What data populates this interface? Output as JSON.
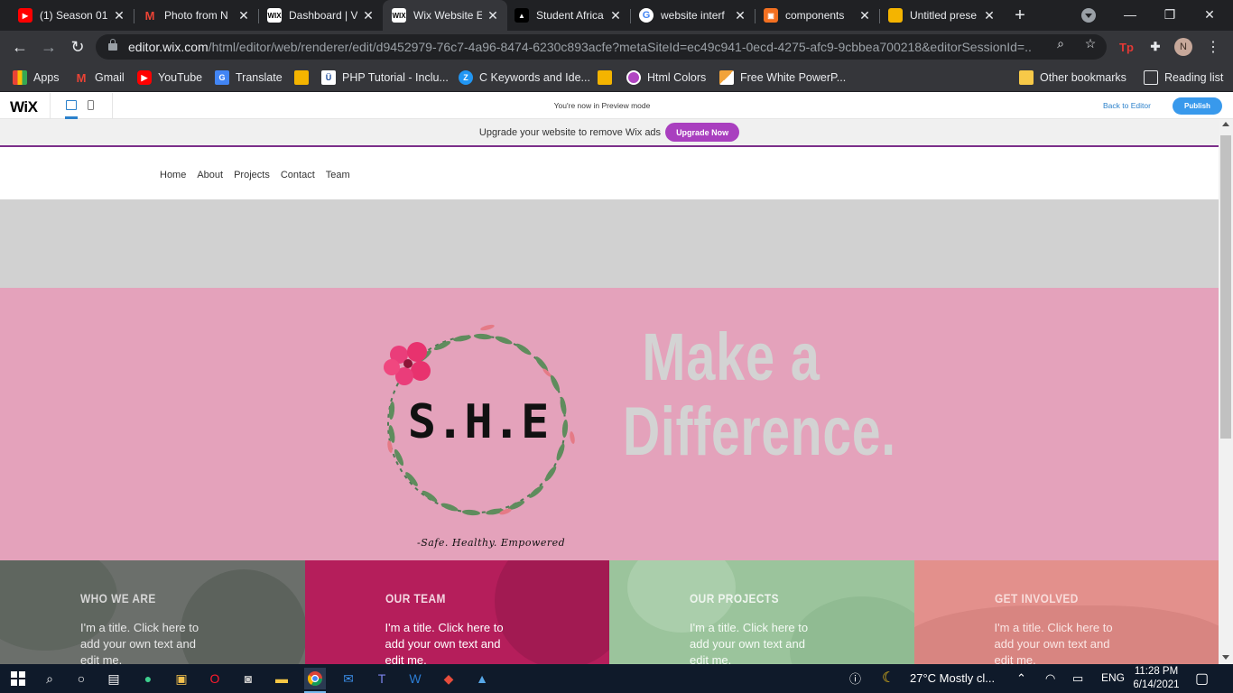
{
  "browser": {
    "tabs": [
      {
        "title": "(1) Season 01",
        "icon": "youtube-icon",
        "color": "#ff0000"
      },
      {
        "title": "Photo from N",
        "icon": "gmail-icon",
        "color": "#ea4335"
      },
      {
        "title": "Dashboard | V",
        "icon": "wix-icon",
        "color": "#ffffff"
      },
      {
        "title": "Wix Website E",
        "icon": "wix-icon",
        "color": "#ffffff"
      },
      {
        "title": "Student Africa",
        "icon": "student-icon",
        "color": "#000000"
      },
      {
        "title": "website interf",
        "icon": "google-icon",
        "color": "#ffffff"
      },
      {
        "title": "components",
        "icon": "components-icon",
        "color": "#f37021"
      },
      {
        "title": "Untitled prese",
        "icon": "slides-icon",
        "color": "#f4b400"
      }
    ],
    "new_tab_label": "+",
    "url_host": "editor.wix.com",
    "url_path": "/html/editor/web/renderer/edit/d9452979-76c7-4a96-8474-6230c893acfe?metaSiteId=ec49c941-0ecd-4275-afc9-9cbbea700218&editorSessionId=...",
    "profile_initial": "N",
    "ext_label": "Tp"
  },
  "bookmarks": [
    {
      "label": "Apps",
      "icon": "apps-grid-icon",
      "color": "#ea4335"
    },
    {
      "label": "Gmail",
      "icon": "gmail-icon",
      "color": "#ea4335"
    },
    {
      "label": "YouTube",
      "icon": "youtube-icon",
      "color": "#ff0000"
    },
    {
      "label": "Translate",
      "icon": "translate-icon",
      "color": "#4285f4"
    },
    {
      "label": "",
      "icon": "classroom-icon",
      "color": "#f4b400"
    },
    {
      "label": "PHP Tutorial - Inclu...",
      "icon": "tutorial-icon",
      "color": "#ffffff"
    },
    {
      "label": "C Keywords and Ide...",
      "icon": "c-keywords-icon",
      "color": "#2196f3"
    },
    {
      "label": "",
      "icon": "classroom-icon",
      "color": "#f4b400"
    },
    {
      "label": "Html Colors",
      "icon": "html-colors-icon",
      "color": "#b146c2"
    },
    {
      "label": "Free White PowerP...",
      "icon": "powerpoint-icon",
      "color": "#f2a33a"
    }
  ],
  "other_bookmarks": "Other bookmarks",
  "reading_list": "Reading list",
  "wix_bar": {
    "logo": "WiX",
    "preview_text": "You're now in Preview mode",
    "back_to_editor": "Back to Editor",
    "publish": "Publish"
  },
  "site": {
    "ad_text": "Upgrade your website to remove Wix ads",
    "upgrade_button": "Upgrade Now",
    "nav": [
      "Home",
      "About",
      "Projects",
      "Contact",
      "Team"
    ],
    "logo_text": "S.H.E",
    "tagline": "-Safe. Healthy. Empowered",
    "headline_1": "Make a",
    "headline_2": "Difference.",
    "cards": [
      {
        "title": "WHO WE ARE",
        "body": "I'm a title. Click here to add your own text and edit me.",
        "bg": "#6b6f6b",
        "title_color": "#d6d6d6",
        "body_color": "#e8e8e8"
      },
      {
        "title": "OUR TEAM",
        "body": "I'm a title. Click here to add your own text and edit me.",
        "bg": "#b51e5b",
        "title_color": "#f3d6e1",
        "body_color": "#ffffff"
      },
      {
        "title": "OUR PROJECTS",
        "body": "I'm a title. Click here to add your own text and edit me.",
        "bg": "#9bc49c",
        "title_color": "#eef5ee",
        "body_color": "#f5fbf5"
      },
      {
        "title": "GET INVOLVED",
        "body": "I'm a title. Click here to add your own text and edit me.",
        "bg": "#e3908c",
        "title_color": "#f8dcda",
        "body_color": "#fbe7e5"
      }
    ]
  },
  "taskbar": {
    "weather": "27°C  Mostly cl...",
    "language": "ENG",
    "time": "11:28 PM",
    "date": "6/14/2021"
  }
}
